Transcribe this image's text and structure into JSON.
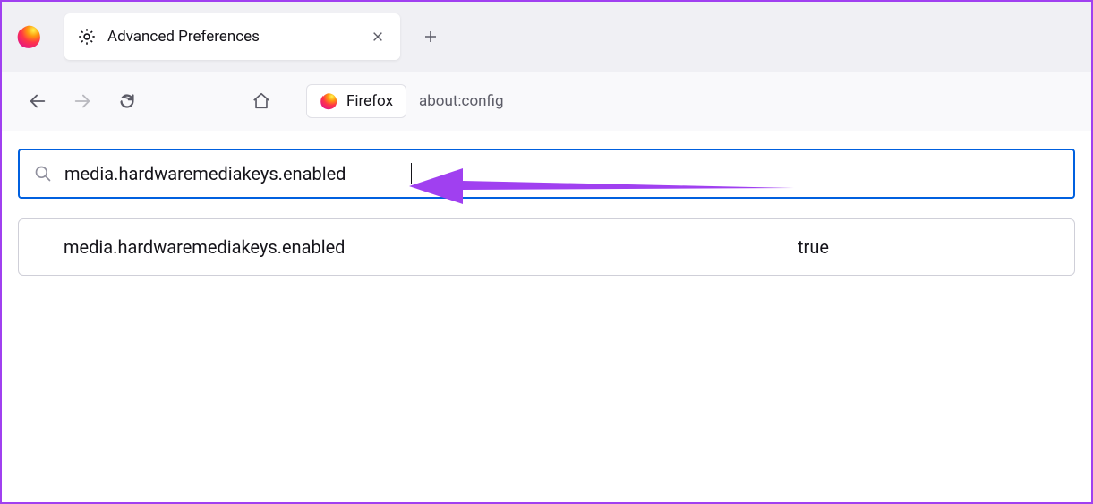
{
  "tab": {
    "title": "Advanced Preferences"
  },
  "urlbar": {
    "identity_label": "Firefox",
    "url": "about:config"
  },
  "search": {
    "value": "media.hardwaremediakeys.enabled"
  },
  "pref": {
    "name": "media.hardwaremediakeys.enabled",
    "value": "true"
  },
  "annotation": {
    "color": "#a040f0"
  }
}
